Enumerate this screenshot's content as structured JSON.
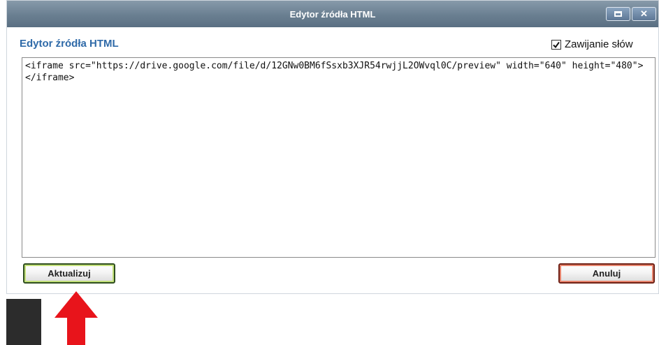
{
  "window": {
    "title": "Edytor źródła HTML",
    "maximize_icon": "maximize-icon",
    "close_icon": "close-icon",
    "close_glyph": "✕"
  },
  "editor": {
    "heading": "Edytor źródła HTML",
    "wrap_label": "Zawijanie słów",
    "wrap_checked": true,
    "content": "<iframe src=\"https://drive.google.com/file/d/12GNw0BM6fSsxb3XJR54rwjjL2OWvql0C/preview\" width=\"640\" height=\"480\"></iframe>"
  },
  "buttons": {
    "update": "Aktualizuj",
    "cancel": "Anuluj"
  },
  "colors": {
    "title_bar": "#6a7f91",
    "heading": "#2f6aa8",
    "arrow": "#e8141b"
  }
}
